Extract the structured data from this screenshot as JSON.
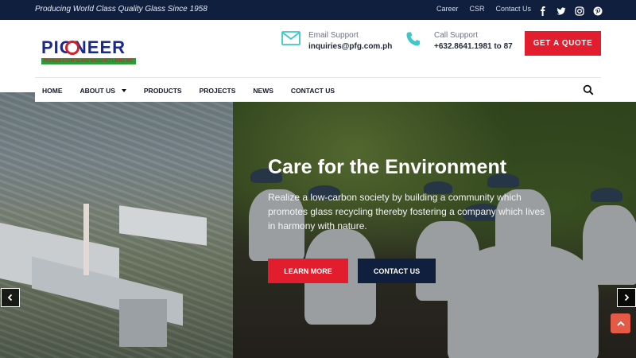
{
  "topbar": {
    "tagline": "Producing World Class Quality Glass Since 1958",
    "links": [
      "Career",
      "CSR",
      "Contact Us"
    ],
    "socials": [
      "facebook-icon",
      "twitter-icon",
      "instagram-icon",
      "pinterest-icon"
    ]
  },
  "header": {
    "logo_text": "PIONEER",
    "logo_subtext": "PIONEER FLOAT GLASS MANUFACTURING INC.",
    "email_label": "Email Support",
    "email_value": "inquiries@pfg.com.ph",
    "call_label": "Call Support",
    "call_value": "+632.8641.1981 to 87",
    "quote_button": "GET A QUOTE"
  },
  "nav": {
    "items": [
      "HOME",
      "ABOUT US",
      "PRODUCTS",
      "PROJECTS",
      "NEWS",
      "CONTACT US"
    ]
  },
  "hero": {
    "title": "Care for the Environment",
    "text": "Realize a low-carbon society by building a community which promotes glass recycling thereby fostering a company which lives in harmony with nature.",
    "learn_more": "LEARN MORE",
    "contact_us": "CONTACT US"
  },
  "colors": {
    "navy": "#0f1f3d",
    "red": "#e11d2e",
    "accent": "#3ec6c9"
  }
}
